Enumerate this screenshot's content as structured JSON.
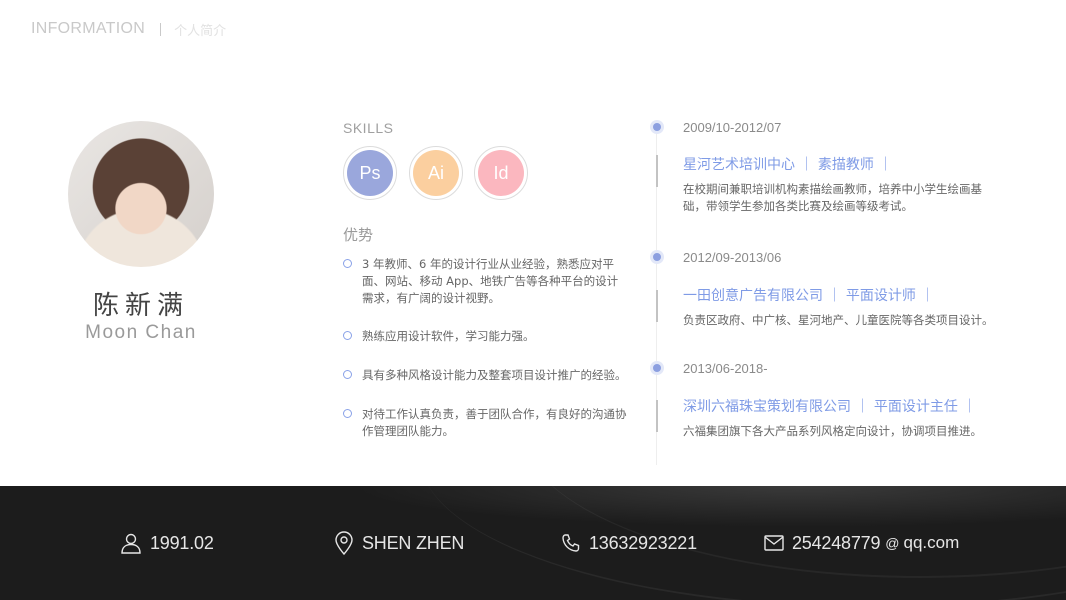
{
  "header": {
    "title_en": "INFORMATION",
    "title_cn": "个人简介"
  },
  "profile": {
    "name_cn": "陈新满",
    "name_en": "Moon Chan"
  },
  "skills": {
    "title": "SKILLS",
    "items": [
      {
        "label": "Ps",
        "color": "#9aa7dc"
      },
      {
        "label": "Ai",
        "color": "#fbcf9f"
      },
      {
        "label": "Id",
        "color": "#fbb7bf"
      }
    ]
  },
  "advantages": {
    "title": "优势",
    "items": [
      "3 年教师、6 年的设计行业从业经验，熟悉应对平面、网站、移动 App、地铁广告等各种平台的设计需求，有广阔的设计视野。",
      "熟练应用设计软件，学习能力强。",
      "具有多种风格设计能力及整套项目设计推广的经验。",
      "对待工作认真负责，善于团队合作，有良好的沟通协作管理团队能力。"
    ]
  },
  "timeline": [
    {
      "date": "2009/10-2012/07",
      "heading": "星河艺术培训中心 ｜ 素描教师 ｜",
      "desc": "在校期间兼职培训机构素描绘画教师，培养中小学生绘画基础，带领学生参加各类比赛及绘画等级考试。"
    },
    {
      "date": "2012/09-2013/06",
      "heading": "一田创意广告有限公司 ｜ 平面设计师 ｜",
      "desc": "负责区政府、中广核、星河地产、儿童医院等各类项目设计。"
    },
    {
      "date": "2013/06-2018-",
      "heading": "深圳六福珠宝策划有限公司 ｜ 平面设计主任 ｜",
      "desc": "六福集团旗下各大产品系列风格定向设计，协调项目推进。"
    }
  ],
  "footer": {
    "birth": "1991.02",
    "city": "SHEN ZHEN",
    "phone": "13632923221",
    "email_user": "254248779",
    "email_at": "@",
    "email_domain": "qq.com",
    "icons": [
      "user-icon",
      "location-pin-icon",
      "phone-icon",
      "mail-icon"
    ]
  }
}
